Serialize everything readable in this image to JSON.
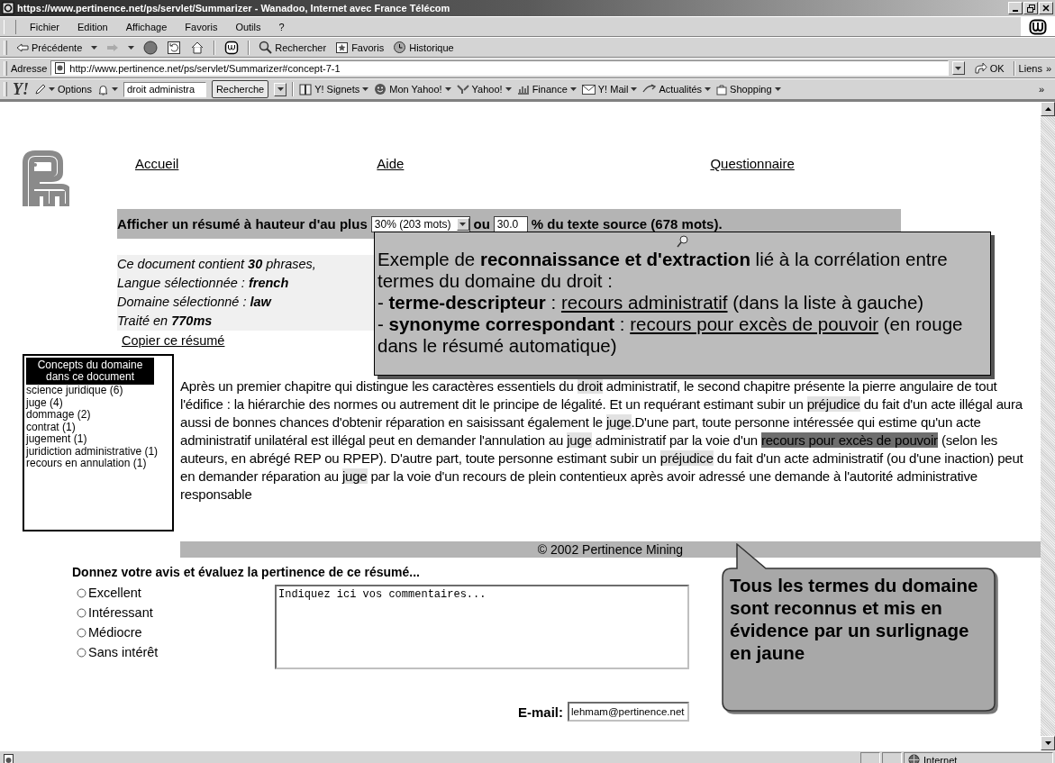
{
  "window": {
    "title": "https://www.pertinence.net/ps/servlet/Summarizer - Wanadoo, Internet avec France Télécom"
  },
  "menu": [
    "Fichier",
    "Edition",
    "Affichage",
    "Favoris",
    "Outils",
    "?"
  ],
  "toolbar": {
    "back": "Précédente",
    "search": "Rechercher",
    "favorites": "Favoris",
    "history": "Historique"
  },
  "address": {
    "label": "Adresse",
    "url": "http://www.pertinence.net/ps/servlet/Summarizer#concept-7-1",
    "go": "OK",
    "links": "Liens",
    "more": "»"
  },
  "yahoo": {
    "logo": "Y!",
    "options": "Options",
    "query": "droit administra",
    "search": "Recherche",
    "items": [
      {
        "label": "Y! Signets",
        "kind": "book"
      },
      {
        "label": "Mon Yahoo!",
        "kind": "smiley"
      },
      {
        "label": "Yahoo!",
        "kind": "logo"
      },
      {
        "label": "Finance",
        "kind": "chart"
      },
      {
        "label": "Y! Mail",
        "kind": "mail"
      },
      {
        "label": "Actualités",
        "kind": "news"
      },
      {
        "label": "Shopping",
        "kind": "bag"
      }
    ],
    "more": "»"
  },
  "nav": [
    "Accueil",
    "Aide",
    "Questionnaire"
  ],
  "summary_bar": {
    "label": "Afficher un résumé à hauteur d'au plus",
    "select": "30% (203 mots)",
    "or": "ou",
    "percent": "30.0",
    "suffix": "% du texte source (678 mots)."
  },
  "stats": [
    "Ce document contient **30** phrases,",
    "Langue sélectionnée : **french**",
    "Domaine sélectionné : **law**",
    "Traité en **770ms**"
  ],
  "copy_link": "Copier ce résumé",
  "concepts": {
    "title": "Concepts du domaine dans ce document",
    "items": [
      {
        "term": "science juridique",
        "count": "(6)"
      },
      {
        "term": "juge",
        "count": "(4)"
      },
      {
        "term": "dommage",
        "count": "(2)"
      },
      {
        "term": "contrat",
        "count": "(1)"
      },
      {
        "term": "jugement",
        "count": "(1)"
      },
      {
        "term": "juridiction administrative",
        "count": "(1)"
      },
      {
        "term": "recours en annulation",
        "count": "(1)"
      }
    ]
  },
  "summary": {
    "segments": [
      {
        "text": "Après un premier chapitre qui distingue les caractères essentiels du ",
        "kind": "plain"
      },
      {
        "text": "droit",
        "kind": "term"
      },
      {
        "text": " administratif, le second chapitre présente la pierre angulaire de tout l'édifice : la hiérarchie des normes ou autrement dit le principe de légalité. Et un requérant estimant subir un ",
        "kind": "plain"
      },
      {
        "text": "préjudice",
        "kind": "term"
      },
      {
        "text": " du fait d'un acte illégal aura aussi de bonnes chances d'obtenir réparation en saisissant également le ",
        "kind": "plain"
      },
      {
        "text": "juge",
        "kind": "term"
      },
      {
        "text": ".D'une part, toute personne intéressée qui estime qu'un acte administratif unilatéral est illégal peut en demander l'annulation au ",
        "kind": "plain"
      },
      {
        "text": "juge",
        "kind": "term"
      },
      {
        "text": " administratif par la voie d'un ",
        "kind": "plain"
      },
      {
        "text": "recours pour excès de pouvoir",
        "kind": "synonym"
      },
      {
        "text": " (selon les auteurs, en abrégé REP ou RPEP). D'autre part, toute personne estimant subir un ",
        "kind": "plain"
      },
      {
        "text": "préjudice",
        "kind": "term"
      },
      {
        "text": " du fait d'un acte administratif (ou d'une inaction) peut en demander réparation au ",
        "kind": "plain"
      },
      {
        "text": "juge",
        "kind": "term"
      },
      {
        "text": " par la voie d'un recours de plein contentieux après avoir adressé une demande à l'autorité administrative responsable",
        "kind": "plain"
      }
    ]
  },
  "footer": "© 2002 Pertinence Mining",
  "feedback": {
    "title": "Donnez votre avis et évaluez la pertinence de ce résumé...",
    "options": [
      {
        "label": "Excellent",
        "selected": false
      },
      {
        "label": "Intéressant",
        "selected": false
      },
      {
        "label": "Médiocre",
        "selected": false
      },
      {
        "label": "Sans intérêt",
        "selected": false
      }
    ],
    "comment_placeholder": "Indiquez ici vos commentaires...",
    "email_label": "E-mail:",
    "email": "lehmam@pertinence.net"
  },
  "tooltip": {
    "intro": "Exemple de **reconnaissance et d'extraction** lié à la corrélation entre termes du domaine du droit :",
    "items": [
      {
        "label": "- **terme-descripteur** :",
        "term": "recours administratif",
        "note": "(dans la liste à gauche)"
      },
      {
        "label": "- **synonyme correspondant** :",
        "term": "recours pour excès de pouvoir",
        "note": "(en rouge dans le résumé automatique)"
      }
    ]
  },
  "callout": "Tous les termes du domaine sont reconnus et mis en évidence par un surlignage en jaune",
  "status_bar": {
    "zone": "Internet"
  }
}
